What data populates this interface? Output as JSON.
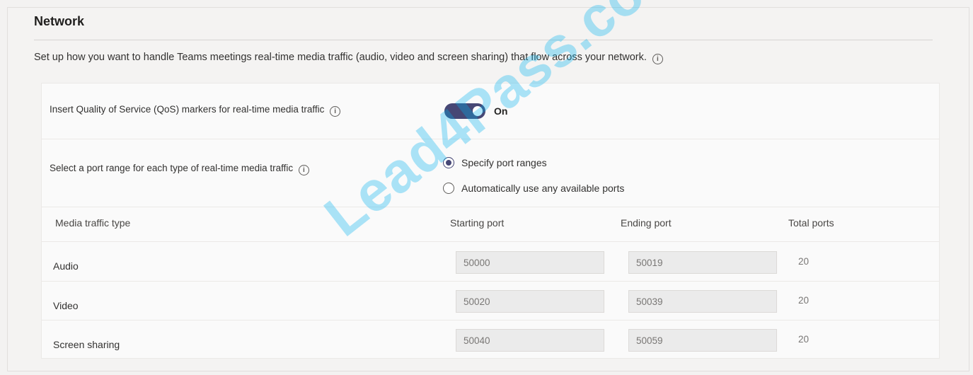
{
  "section": {
    "title": "Network",
    "description": "Set up how you want to handle Teams meetings real-time media traffic (audio, video and screen sharing) that flow across your network."
  },
  "qos": {
    "label": "Insert Quality of Service (QoS) markers for real-time media traffic",
    "toggle_state": "On",
    "enabled": true
  },
  "ports": {
    "label": "Select a port range for each type of real-time media traffic",
    "options": [
      {
        "label": "Specify port ranges",
        "selected": true
      },
      {
        "label": "Automatically use any available ports",
        "selected": false
      }
    ]
  },
  "table": {
    "headers": [
      "Media traffic type",
      "Starting port",
      "Ending port",
      "Total ports"
    ],
    "rows": [
      {
        "type": "Audio",
        "start": "50000",
        "end": "50019",
        "total": "20"
      },
      {
        "type": "Video",
        "start": "50020",
        "end": "50039",
        "total": "20"
      },
      {
        "type": "Screen sharing",
        "start": "50040",
        "end": "50059",
        "total": "20"
      }
    ]
  },
  "watermark": "Lead4Pass.com",
  "colors": {
    "accent": "#464775",
    "background": "#f3f2f1"
  }
}
